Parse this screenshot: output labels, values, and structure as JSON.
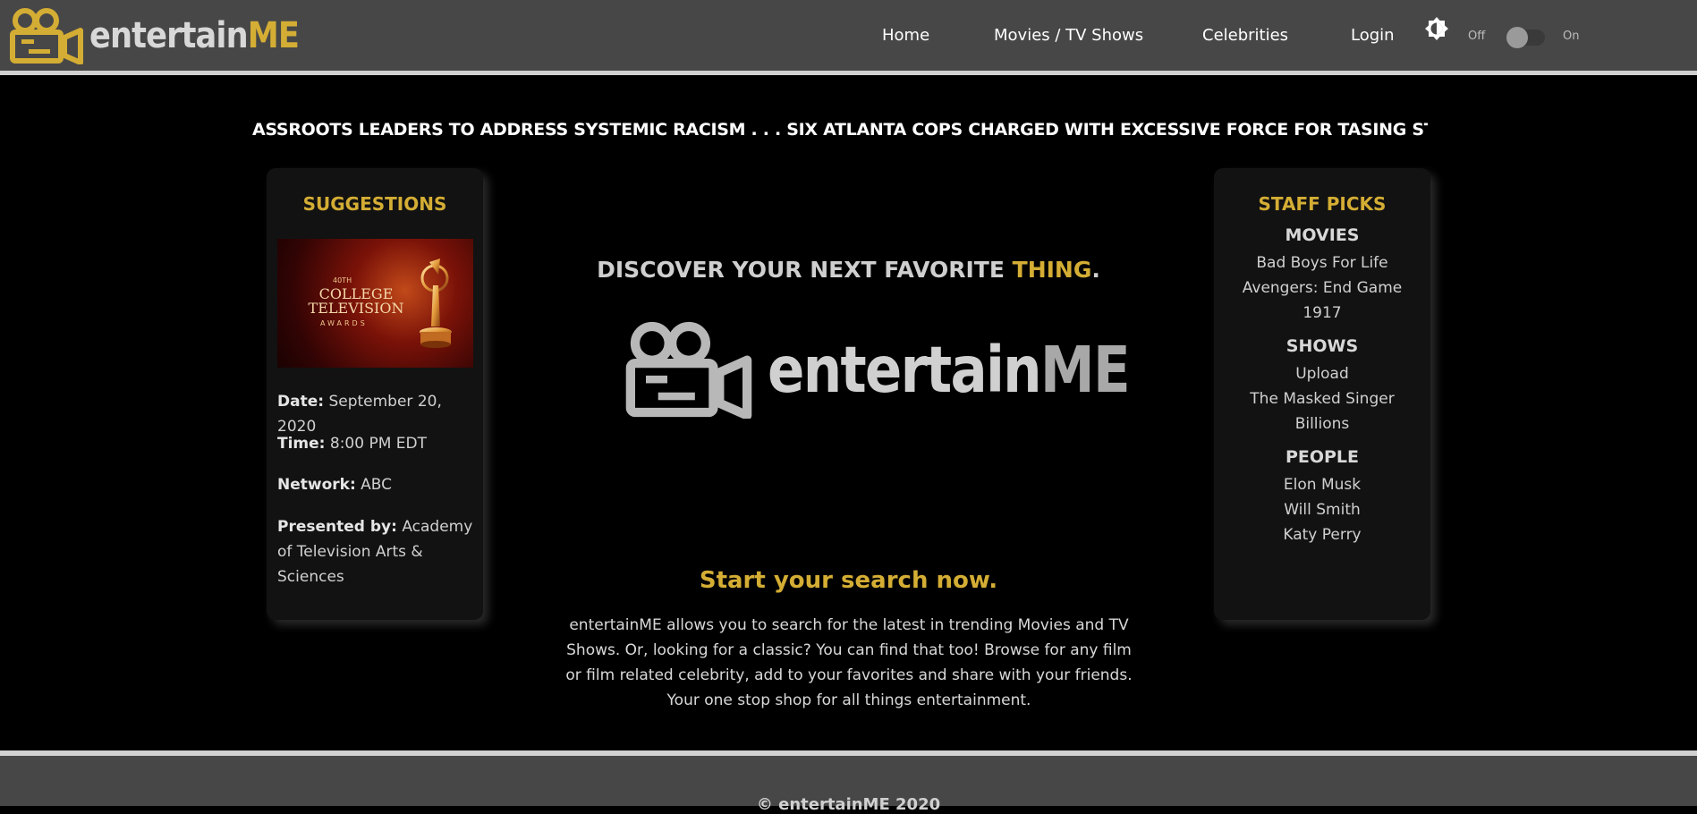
{
  "nav": {
    "brand_main": "entertain",
    "brand_accent": "ME",
    "links": [
      "Home",
      "Movies / TV Shows",
      "Celebrities",
      "Login"
    ],
    "toggle_off": "Off",
    "toggle_on": "On",
    "mode_icon": "brightness-icon"
  },
  "ticker": {
    "text": "ASSROOTS LEADERS TO ADDRESS SYSTEMIC RACISM . . . SIX ATLANTA COPS CHARGED WITH EXCESSIVE FORCE FOR TASING STUDENTS . . . GE"
  },
  "suggestions": {
    "title": "SUGGESTIONS",
    "image_line1": "40TH",
    "image_line2": "COLLEGE TELEVISION",
    "image_line3": "AWARDS",
    "date_label": "Date:",
    "date_value": "September 20, 2020",
    "time_label": "Time:",
    "time_value": "8:00 PM EDT",
    "network_label": "Network:",
    "network_value": "ABC",
    "presented_label": "Presented by:",
    "presented_value": "Academy of Television Arts & Sciences"
  },
  "staff_picks": {
    "title": "STAFF PICKS",
    "movies_head": "MOVIES",
    "movies": [
      "Bad Boys For Life",
      "Avengers: End Game",
      "1917"
    ],
    "shows_head": "SHOWS",
    "shows": [
      "Upload",
      "The Masked Singer",
      "Billions"
    ],
    "people_head": "PEOPLE",
    "people": [
      "Elon Musk",
      "Will Smith",
      "Katy Perry"
    ]
  },
  "hero": {
    "discover_pre": "DISCOVER YOUR NEXT FAVORITE ",
    "discover_hl": "THING",
    "discover_post": ".",
    "logo_main": "entertain",
    "logo_accent": "ME",
    "start": "Start your search now.",
    "blurb": "entertainME allows you to search for the latest in trending Movies and TV Shows. Or, looking for a classic? You can find that too! Browse for any film or film related celebrity, add to your favorites and share with your friends. Your one stop shop for all things entertainment."
  },
  "footer": {
    "text": "© entertainME 2020"
  },
  "colors": {
    "accent": "#d4ad34",
    "nav_bg": "#474747",
    "page_bg": "#000000",
    "card_bg": "#121212"
  }
}
